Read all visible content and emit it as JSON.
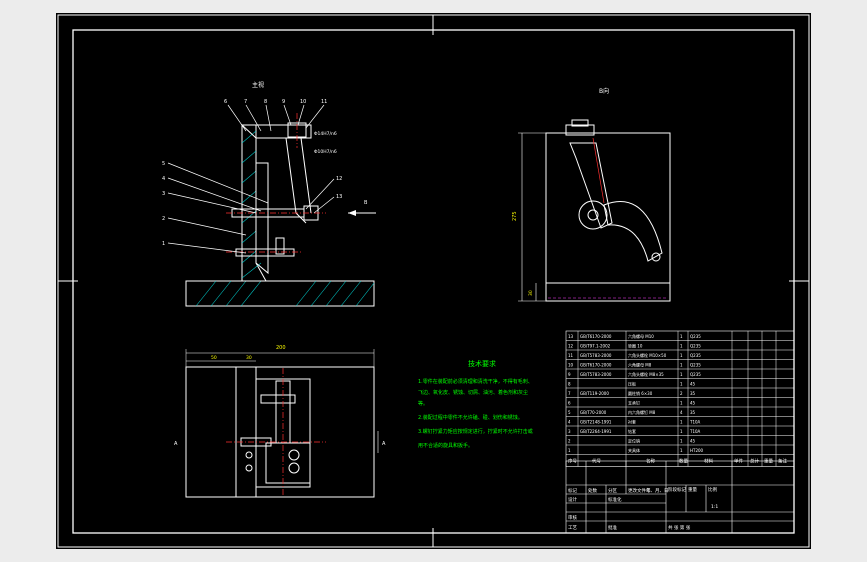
{
  "colors": {
    "background": "#ececec",
    "sheet": "#000000",
    "frame": "#ffffff",
    "part_outline": "#ffffff",
    "hatch": "#00c8c8",
    "centerline": "#ff3030",
    "dimension": "#ff3030",
    "dimension_text": "#ffff00",
    "notes_text": "#00ff00",
    "table_text": "#ffffff",
    "leader": "#ffffff"
  },
  "views": {
    "main_title": "主视",
    "side_title": "B向",
    "arrow_label": "B",
    "section_label": "A",
    "top_label": "A"
  },
  "balloons": [
    "1",
    "2",
    "3",
    "4",
    "5",
    "6",
    "7",
    "8",
    "9",
    "10",
    "11",
    "12",
    "13"
  ],
  "dimensions": {
    "overall_width": "200",
    "left_offset": "50",
    "second_offset": "30",
    "side_height": "275",
    "base_height": "30"
  },
  "fits": {
    "fit1": "Φ14H7/n6",
    "fit2": "Φ10H7/n6"
  },
  "notes": {
    "title": "技术要求",
    "lines": [
      "1.零件在装配前必须清理和清洗干净，不得有毛刺、",
      "飞边、氧化皮、锈蚀、切屑、油污、着色剂和灰尘",
      "等。",
      "2.装配过程中零件不允许磕、碰、划伤和锈蚀。",
      "3.螺钉拧紧力矩应按规定进行，拧紧时不允许打击或",
      "用不合适的旋具和扳手。"
    ]
  },
  "bom": {
    "rows": [
      {
        "no": "13",
        "code": "GB/T6170-2000",
        "name": "六角螺母 M10",
        "qty": "1",
        "mat": "Q235"
      },
      {
        "no": "12",
        "code": "GB/T97.1-2002",
        "name": "垫圈 10",
        "qty": "1",
        "mat": "Q235"
      },
      {
        "no": "11",
        "code": "GB/T5783-2000",
        "name": "六角头螺栓 M10×50",
        "qty": "1",
        "mat": "Q235"
      },
      {
        "no": "10",
        "code": "GB/T6170-2000",
        "name": "六角螺母 M8",
        "qty": "1",
        "mat": "Q235"
      },
      {
        "no": "9",
        "code": "GB/T5783-2000",
        "name": "六角头螺栓 M8×35",
        "qty": "1",
        "mat": "Q235"
      },
      {
        "no": "8",
        "code": "",
        "name": "压板",
        "qty": "1",
        "mat": "45"
      },
      {
        "no": "7",
        "code": "GB/T119-2000",
        "name": "圆柱销 6×30",
        "qty": "2",
        "mat": "35"
      },
      {
        "no": "6",
        "code": "",
        "name": "支承钉",
        "qty": "1",
        "mat": "45"
      },
      {
        "no": "5",
        "code": "GB/T70-2000",
        "name": "内六角螺钉 M8",
        "qty": "4",
        "mat": "35"
      },
      {
        "no": "4",
        "code": "GB/T2148-1991",
        "name": "衬套",
        "qty": "1",
        "mat": "T10A"
      },
      {
        "no": "3",
        "code": "GB/T2264-1991",
        "name": "钻套",
        "qty": "1",
        "mat": "T10A"
      },
      {
        "no": "2",
        "code": "",
        "name": "定位销",
        "qty": "1",
        "mat": "45"
      },
      {
        "no": "1",
        "code": "",
        "name": "夹具体",
        "qty": "1",
        "mat": "HT200"
      }
    ],
    "header": {
      "no": "序号",
      "code": "代号",
      "name": "名称",
      "qty": "数量",
      "mat": "材料",
      "unit": "单件",
      "total": "总计",
      "weight": "重量",
      "remark": "备注"
    }
  },
  "title_block": {
    "mark": "标记",
    "count": "处数",
    "zone": "分区",
    "change": "更改文件号",
    "sign": "签名",
    "date": "年、月、日",
    "design": "设计",
    "std": "标准化",
    "review": "审核",
    "process": "工艺",
    "approve": "批准",
    "stage": "阶段标记",
    "weight": "重量",
    "scale": "比例",
    "ratio": "1:1",
    "sheets": "共 张 第 张"
  }
}
